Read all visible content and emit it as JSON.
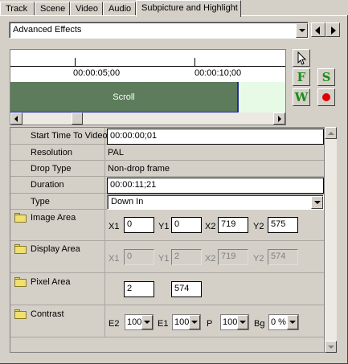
{
  "tabs": [
    {
      "label": "Track",
      "active": false
    },
    {
      "label": "Scene",
      "active": false
    },
    {
      "label": "Video",
      "active": false
    },
    {
      "label": "Audio",
      "active": false
    },
    {
      "label": "Subpicture and Highlight",
      "active": true
    }
  ],
  "effect_select": {
    "value": "Advanced Effects"
  },
  "timeline": {
    "ticks": [
      "00:00:05;00",
      "00:00:10;00"
    ],
    "clip_label": "Scroll"
  },
  "tools": {
    "pointer": "pointer-icon",
    "f_label": "F",
    "s_label": "S",
    "w_label": "W",
    "record": "record-icon"
  },
  "properties": {
    "start_time": {
      "label": "Start Time To Video",
      "value": "00:00:00;01"
    },
    "resolution": {
      "label": "Resolution",
      "value": "PAL"
    },
    "drop_type": {
      "label": "Drop Type",
      "value": "Non-drop frame"
    },
    "duration": {
      "label": "Duration",
      "value": "00:00:11;21"
    },
    "type": {
      "label": "Type",
      "value": "Down In"
    },
    "image_area": {
      "label": "Image Area",
      "x1_label": "X1",
      "x1": "0",
      "y1_label": "Y1",
      "y1": "0",
      "x2_label": "X2",
      "x2": "719",
      "y2_label": "Y2",
      "y2": "575"
    },
    "display_area": {
      "label": "Display Area",
      "x1_label": "X1",
      "x1": "0",
      "y1_label": "Y1",
      "y1": "2",
      "x2_label": "X2",
      "x2": "719",
      "y2_label": "Y2",
      "y2": "574"
    },
    "pixel_area": {
      "label": "Pixel Area",
      "v1": "2",
      "v2": "574"
    },
    "contrast": {
      "label": "Contrast",
      "e2_label": "E2",
      "e2": "100",
      "e1_label": "E1",
      "e1": "100",
      "p_label": "P",
      "p": "100",
      "bg_label": "Bg",
      "bg": "0 %"
    }
  },
  "colors": {
    "clip_green": "#5c7c5c",
    "clip_light": "#e6fae6",
    "f_color": "#1c8c1c",
    "s_color": "#1c8c1c",
    "w_color": "#1c8c1c",
    "record_color": "#e00000"
  }
}
